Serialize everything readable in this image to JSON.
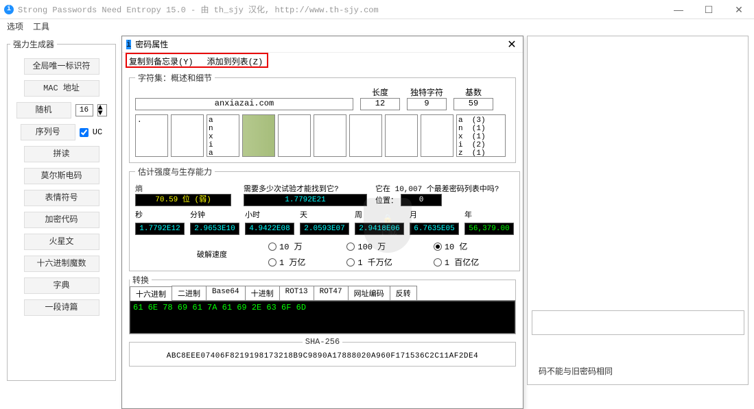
{
  "window": {
    "title": "Strong Passwords Need Entropy 15.0 - 由 th_sjy 汉化, http://www.th-sjy.com"
  },
  "menu": {
    "options": "选项",
    "tools": "工具"
  },
  "sidebar": {
    "legend": "强力生成器",
    "buttons": [
      "全局唯一标识符",
      "MAC 地址",
      "随机",
      "序列号",
      "拼读",
      "莫尔斯电码",
      "表情符号",
      "加密代码",
      "火星文",
      "十六进制魔数",
      "字典",
      "一段诗篇"
    ],
    "spinner_value": "16",
    "uc_label": "UC"
  },
  "right": {
    "msg": "码不能与旧密码相同"
  },
  "dialog": {
    "title": "密码属性",
    "menu_copy": "复制到备忘录(Y)",
    "menu_add": "添加到列表(Z)",
    "charset": {
      "legend": "字符集：概述和细节",
      "password": "anxiazai.com",
      "label_len": "长度",
      "label_unique": "独特字符",
      "label_radix": "基数",
      "len": "12",
      "unique": "9",
      "radix": "59",
      "box0": ".",
      "box1": "a\nn\nx\ni\na",
      "box_wide": "a  (3)\nn  (1)\nx  (1)\ni  (2)\nz  (1)"
    },
    "strength": {
      "legend": "估计强度与生存能力",
      "entropy_label": "熵",
      "entropy": "70.59 位 (弱)",
      "tries_label": "需要多少次试验才能找到它?",
      "tries": "1.7792E21",
      "worst_label": "它在 10,007 个最差密码列表中吗?",
      "worst_pos_label": "位置：",
      "worst_pos": "0",
      "time_labels": [
        "秒",
        "分钟",
        "小时",
        "天",
        "周",
        "月",
        "年"
      ],
      "time_values": [
        "1.7792E12",
        "2.9653E10",
        "4.9422E08",
        "2.0593E07",
        "2.9418E06",
        "6.7635E05",
        "56,379.00"
      ],
      "crack_speed_label": "破解速度",
      "radios_top": [
        "10 万",
        "100 万",
        "10 亿"
      ],
      "radios_bot": [
        "1 万亿",
        "1 千万亿",
        "1 百亿亿"
      ],
      "checked": "10 亿"
    },
    "convert": {
      "legend": "转换",
      "tabs": [
        "十六进制",
        "二进制",
        "Base64",
        "十进制",
        "ROT13",
        "ROT47",
        "网址编码",
        "反转"
      ],
      "hex": "61 6E 78 69 61 7A 61 69 2E 63 6F 6D"
    },
    "sha": {
      "legend": "SHA-256",
      "value": "ABC8EEE07406F8219198173218B9C9890A17888020A960F171536C2C11AF2DE4"
    }
  },
  "watermark": {
    "sub": "下载"
  }
}
